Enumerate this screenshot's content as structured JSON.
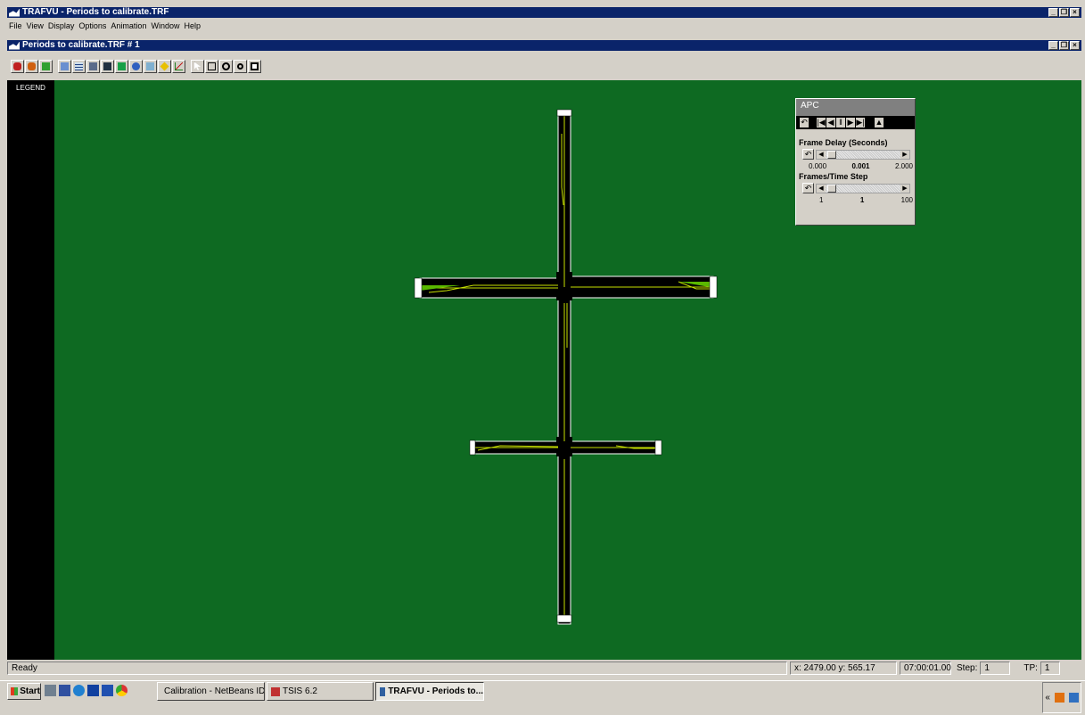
{
  "window": {
    "title": "TRAFVU - Periods to calibrate.TRF"
  },
  "menu": [
    "File",
    "View",
    "Display",
    "Options",
    "Animation",
    "Window",
    "Help"
  ],
  "child": {
    "title": "Periods to calibrate.TRF # 1"
  },
  "legend": {
    "label": "LEGEND"
  },
  "apc": {
    "title": "APC",
    "frame_delay_label": "Frame Delay (Seconds)",
    "frame_delay_min": "0.000",
    "frame_delay_value": "0.001",
    "frame_delay_max": "2.000",
    "frames_label": "Frames/Time Step",
    "frames_min": "1",
    "frames_value": "1",
    "frames_max": "100"
  },
  "status": {
    "text": "Ready",
    "coords": "x:  2479.00  y:   565.17",
    "time": "07:00:01.00",
    "step_label": "Step:",
    "step_value": "1",
    "tp_label": "TP:",
    "tp_value": "1"
  },
  "taskbar": {
    "start": "Start",
    "tasks": [
      "Calibration - NetBeans ID...",
      "TSIS 6.2",
      "TRAFVU - Periods to..."
    ]
  },
  "network": {
    "road_color": "#000000",
    "edge_color": "#ffffff",
    "lane_color": "#c6e000",
    "background": "#0e6a22"
  }
}
